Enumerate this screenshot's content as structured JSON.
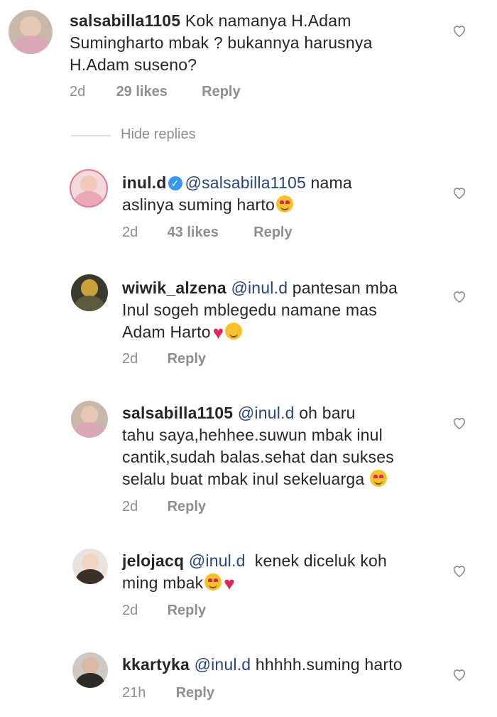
{
  "comments": [
    {
      "user": "salsabilla1105",
      "lines": [
        "Kok namanya H.Adam",
        "Sumingharto mbak ? bukannya harusnya",
        "H.Adam suseno?"
      ],
      "time": "2d",
      "likes": "29 likes",
      "reply": "Reply"
    },
    {
      "user": "inul.d",
      "mention": "@salsabilla1105",
      "lines": [
        "nama",
        "aslinya suming harto"
      ],
      "time": "2d",
      "likes": "43 likes",
      "reply": "Reply"
    },
    {
      "user": "wiwik_alzena",
      "mention": "@inul.d",
      "lines": [
        "pantesan mba",
        "Inul sogeh mblegedu namane mas",
        "Adam Harto"
      ],
      "time": "2d",
      "reply": "Reply"
    },
    {
      "user": "salsabilla1105",
      "mention": "@inul.d",
      "lines": [
        "oh baru",
        "tahu saya,hehhee.suwun mbak inul",
        "cantik,sudah balas.sehat dan sukses",
        "selalu buat mbak inul sekeluarga"
      ],
      "time": "2d",
      "reply": "Reply"
    },
    {
      "user": "jelojacq",
      "mention": "@inul.d",
      "lines": [
        "kenek diceluk koh",
        "ming mbak"
      ],
      "time": "2d",
      "reply": "Reply"
    },
    {
      "user": "kkartyka",
      "mention": "@inul.d",
      "lines": [
        "hhhhh.suming harto"
      ],
      "time": "21h",
      "reply": "Reply"
    }
  ],
  "hide_replies": "Hide replies",
  "icons": {
    "like": "heart-outline-icon",
    "verified": "verified-badge-icon"
  },
  "colors": {
    "mention": "#26457a",
    "meta": "#8e8e8e",
    "verified": "#3897f0"
  }
}
